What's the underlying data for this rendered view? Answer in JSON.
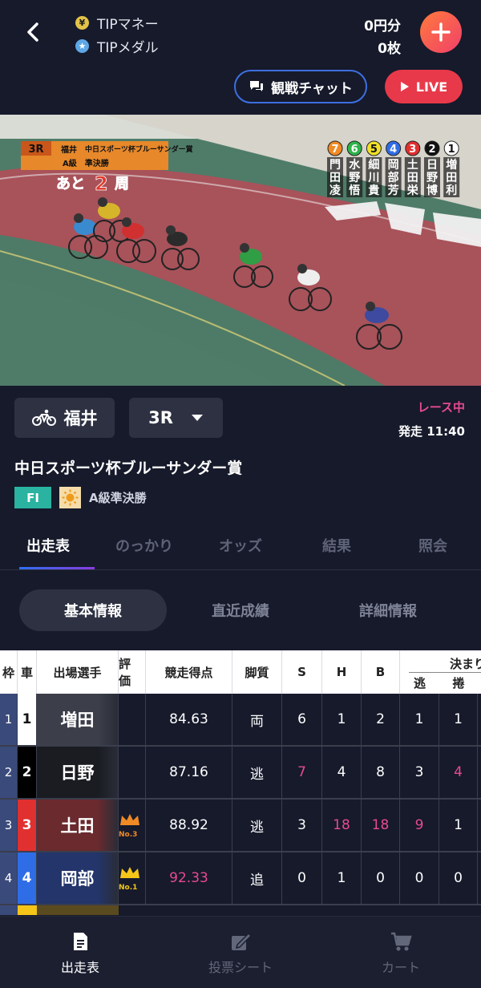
{
  "header": {
    "tip_money_label": "TIPマネー",
    "tip_money_value": "0円分",
    "tip_medal_label": "TIPメダル",
    "tip_medal_value": "0枚",
    "chat_label": "観戦チャット",
    "live_label": "LIVE"
  },
  "video": {
    "race_num": "3R",
    "venue": "福井",
    "race_title": "中日スポーツ杯ブルーサンダー賞",
    "race_grade": "A級　準決勝",
    "laps_prefix": "あと",
    "laps_num": "2",
    "laps_suffix": "周",
    "riders": [
      {
        "num": "7",
        "name1": "門",
        "name2": "田",
        "name3": "凌",
        "color": "#f08a24"
      },
      {
        "num": "6",
        "name1": "水",
        "name2": "野",
        "name3": "悟",
        "color": "#2fb34a"
      },
      {
        "num": "5",
        "name1": "細",
        "name2": "川",
        "name3": "貴",
        "color": "#f0e02a"
      },
      {
        "num": "4",
        "name1": "岡",
        "name2": "部",
        "name3": "芳",
        "color": "#2f6de6"
      },
      {
        "num": "3",
        "name1": "土",
        "name2": "田",
        "name3": "栄",
        "color": "#e03030"
      },
      {
        "num": "2",
        "name1": "日",
        "name2": "野",
        "name3": "博",
        "color": "#111111"
      },
      {
        "num": "1",
        "name1": "増",
        "name2": "田",
        "name3": "利",
        "color": "#ffffff"
      }
    ]
  },
  "race": {
    "venue": "福井",
    "race_no": "3R",
    "status": "レース中",
    "start_time": "発走 11:40",
    "name": "中日スポーツ杯ブルーサンダー賞",
    "badge": "FI",
    "grade": "A級準決勝"
  },
  "tabs": [
    "出走表",
    "のっかり",
    "オッズ",
    "結果",
    "照会"
  ],
  "subtabs": [
    "基本情報",
    "直近成績",
    "詳細情報"
  ],
  "table": {
    "headers": {
      "frame": "枠",
      "car": "車",
      "player": "出場選手",
      "rating": "評価",
      "score": "競走得点",
      "leg": "脚質",
      "s": "S",
      "h": "H",
      "b": "B",
      "decide": "決まり手",
      "nige": "逃",
      "makuri": "捲"
    },
    "rows": [
      {
        "frame": "1",
        "car": "1",
        "player": "増田",
        "crown": "",
        "score": "84.63",
        "leg": "両",
        "s": "6",
        "h": "1",
        "b": "2",
        "nige": "1",
        "makuri": "1",
        "frame_color": "#3a4a7a",
        "car_bg": "#ffffff",
        "car_fg": "#111111",
        "player_bg": "#3c3f4a"
      },
      {
        "frame": "2",
        "car": "2",
        "player": "日野",
        "crown": "",
        "score": "87.16",
        "leg": "逃",
        "s": "7",
        "h": "4",
        "b": "8",
        "nige": "3",
        "makuri": "4",
        "frame_color": "#3a4a7a",
        "car_bg": "#000000",
        "car_fg": "#ffffff",
        "player_bg": "#1a1c22"
      },
      {
        "frame": "3",
        "car": "3",
        "player": "土田",
        "crown": "No.3",
        "score": "88.92",
        "leg": "逃",
        "s": "3",
        "h": "18",
        "b": "18",
        "nige": "9",
        "makuri": "1",
        "frame_color": "#3a4a7a",
        "car_bg": "#e03030",
        "car_fg": "#ffffff",
        "player_bg": "#6a2a2e"
      },
      {
        "frame": "4",
        "car": "4",
        "player": "岡部",
        "crown": "No.1",
        "score": "92.33",
        "leg": "追",
        "s": "0",
        "h": "1",
        "b": "0",
        "nige": "0",
        "makuri": "0",
        "frame_color": "#3a4a7a",
        "car_bg": "#2f6de6",
        "car_fg": "#ffffff",
        "player_bg": "#23356a"
      }
    ]
  },
  "bottom_nav": [
    "出走表",
    "投票シート",
    "カート"
  ]
}
